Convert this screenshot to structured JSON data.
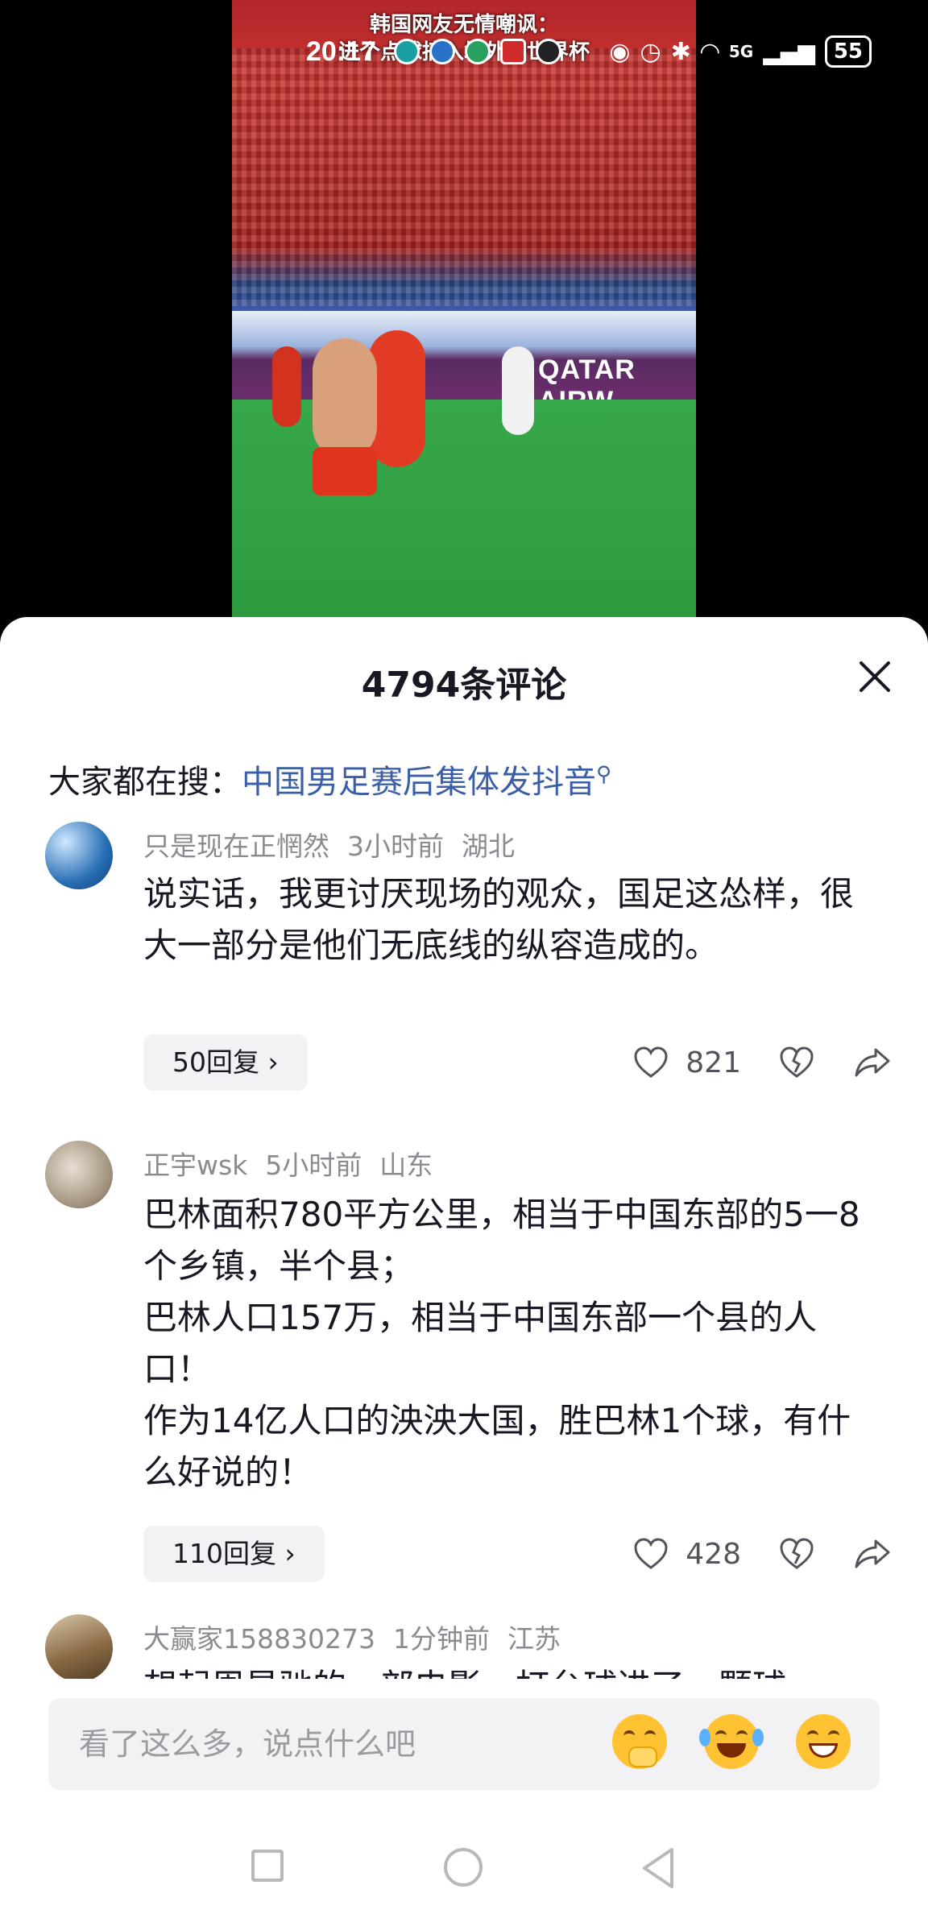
{
  "video": {
    "caption_line1": "韩国网友无情嘲讽：",
    "caption_line2": "进个点球搞入场外得世界杯",
    "ad_text": "QATAR AIRW"
  },
  "status_bar": {
    "time": "20:17",
    "network": "5G",
    "battery": "55"
  },
  "sheet": {
    "title": "4794条评论",
    "hot_search_label": "大家都在搜：",
    "hot_search_link": "中国男足赛后集体发抖音",
    "hot_search_icon": "search-icon"
  },
  "comments": [
    {
      "user": "只是现在正惘然",
      "time": "3小时前",
      "location": "湖北",
      "text": "说实话，我更讨厌现场的观众，国足这怂样，很大一部分是他们无底线的纵容造成的。",
      "replies": "50回复",
      "likes": "821",
      "avatar_color": "#2a6fb5"
    },
    {
      "user": "正宇wsk",
      "time": "5小时前",
      "location": "山东",
      "text": "巴林面积780平方公里，相当于中国东部的5一8个乡镇，半个县；\n巴林人口157万，相当于中国东部一个县的人口！\n作为14亿人口的泱泱大国，胜巴林1个球，有什么好说的！",
      "replies": "110回复",
      "likes": "428",
      "avatar_color": "#a99a86"
    },
    {
      "user": "大赢家158830273",
      "time": "1分钟前",
      "location": "江苏",
      "text": "想起周星驰的一部电影，打台球进了一颗球",
      "avatar_color": "#8a6a45"
    }
  ],
  "input": {
    "placeholder": "看了这么多，说点什么吧",
    "emojis": [
      "hand-over-mouth-emoji",
      "laughing-tears-emoji",
      "grinning-emoji"
    ]
  },
  "navbar": {
    "icons": [
      "recent-apps-icon",
      "home-icon",
      "back-icon"
    ]
  }
}
